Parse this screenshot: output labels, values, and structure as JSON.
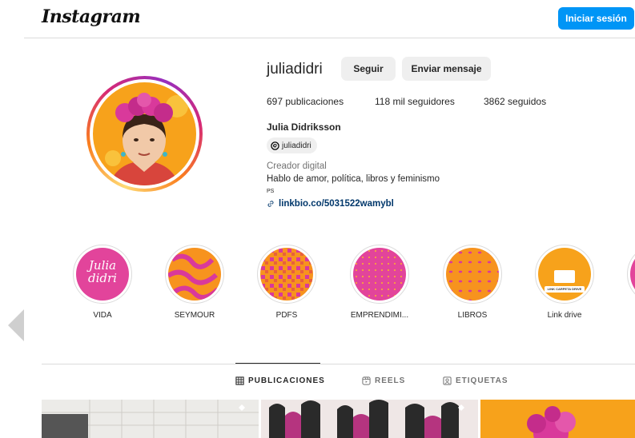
{
  "header": {
    "logo": "Instagram",
    "login_label": "Iniciar sesión"
  },
  "profile": {
    "username": "juliadidri",
    "follow_label": "Seguir",
    "message_label": "Enviar mensaje",
    "stats": {
      "posts": "697 publicaciones",
      "followers": "118 mil seguidores",
      "following": "3862 seguidos"
    },
    "full_name": "Julia Didriksson",
    "threads_handle": "juliadidri",
    "category": "Creador digital",
    "bio": "Hablo de amor, política, libros y feminismo",
    "ps": "PS",
    "link": "linkbio.co/5031522wamybl"
  },
  "highlights": [
    {
      "label": "VIDA",
      "image_text": "Julia didri"
    },
    {
      "label": "SEYMOUR"
    },
    {
      "label": "PDFS"
    },
    {
      "label": "EMPRENDIMI..."
    },
    {
      "label": "LIBROS"
    },
    {
      "label": "Link drive",
      "image_text": "LINK CARPETA DRIVE"
    }
  ],
  "tabs": {
    "posts": "PUBLICACIONES",
    "reels": "REELS",
    "tagged": "ETIQUETAS"
  },
  "colors": {
    "accent": "#0095f6",
    "link": "#00376b",
    "highlight_pink": "#e2449b",
    "highlight_orange": "#f7931e"
  }
}
